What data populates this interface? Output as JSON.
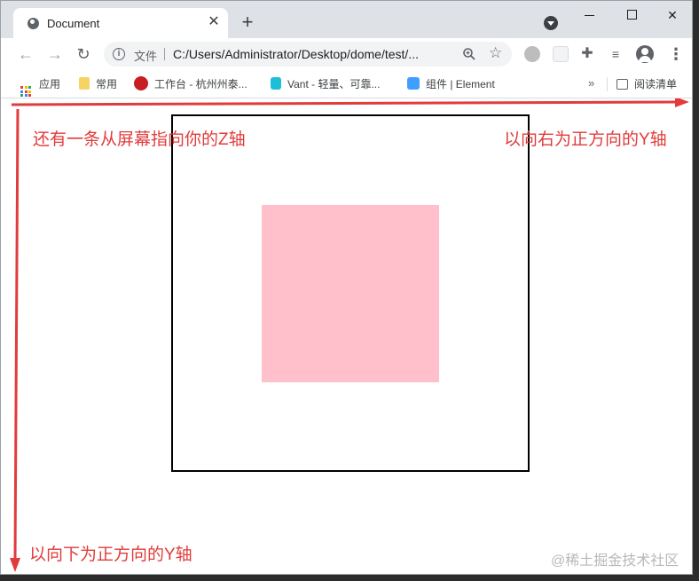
{
  "browser": {
    "tab": {
      "title": "Document",
      "close_glyph": "✕"
    },
    "new_tab_glyph": "+",
    "nav": {
      "back_glyph": "←",
      "forward_glyph": "→",
      "reload_glyph": "↻"
    },
    "omnibox": {
      "scheme_label": "文件",
      "url": "C:/Users/Administrator/Desktop/dome/test/..."
    },
    "star_glyph": "☆",
    "menu_glyph": "⋮",
    "bookmarks": [
      {
        "label": "应用",
        "icon": "apps-grid-icon"
      },
      {
        "label": "常用",
        "icon": "folder-icon"
      },
      {
        "label": "工作台 - 杭州州泰...",
        "icon": "gitee-icon"
      },
      {
        "label": "Vant - 轻量、可靠...",
        "icon": "vant-icon"
      },
      {
        "label": "组件 | Element",
        "icon": "element-icon"
      }
    ],
    "bookmarks_more_glyph": "»",
    "reading_list_label": "阅读清单"
  },
  "page": {
    "note_z": "还有一条从屏幕指向你的Z轴",
    "note_right": "以向右为正方向的Y轴",
    "note_down": "以向下为正方向的Y轴",
    "watermark": "@稀土掘金技术社区"
  },
  "colors": {
    "arrow": "#e23b3b",
    "pink_square": "#ffc0cb",
    "box_border": "#000000"
  }
}
